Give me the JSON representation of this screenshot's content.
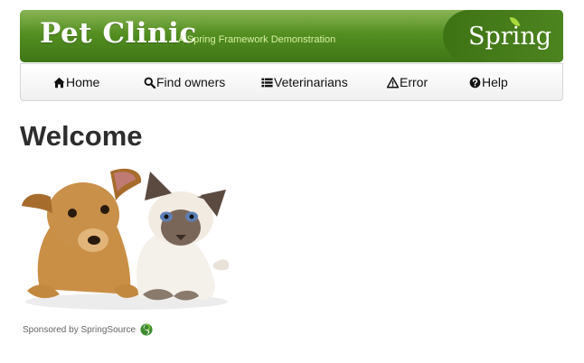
{
  "header": {
    "title": "Pet Clinic",
    "subtitle": "A Spring Framework Demonstration",
    "logo_text": "Spring"
  },
  "nav": {
    "items": [
      {
        "label": "Home",
        "icon": "home-icon"
      },
      {
        "label": "Find owners",
        "icon": "search-icon"
      },
      {
        "label": "Veterinarians",
        "icon": "list-icon"
      },
      {
        "label": "Error",
        "icon": "warning-icon"
      },
      {
        "label": "Help",
        "icon": "help-icon"
      }
    ]
  },
  "main": {
    "heading": "Welcome"
  },
  "footer": {
    "sponsor_text": "Sponsored by SpringSource"
  },
  "colors": {
    "brand_green": "#4f8a1f",
    "subtitle_green": "#d8f0a2",
    "heading": "#2d2d2d"
  }
}
